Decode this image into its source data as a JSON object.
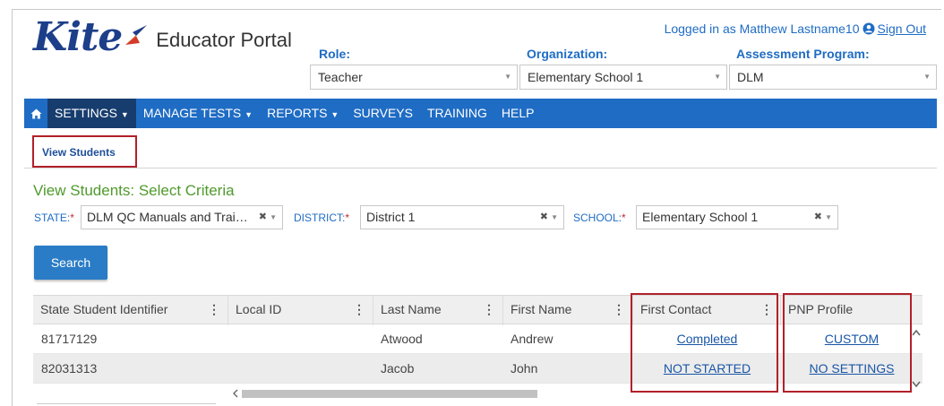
{
  "app": {
    "logo_text": "Kite",
    "portal_name": "Educator Portal"
  },
  "header": {
    "login_prefix": "Logged in as Matthew Lastname10",
    "sign_out": "Sign Out",
    "role_label": "Role:",
    "role_value": "Teacher",
    "org_label": "Organization:",
    "org_value": "Elementary School 1",
    "program_label": "Assessment Program:",
    "program_value": "DLM"
  },
  "nav": {
    "items": [
      {
        "label": "SETTINGS"
      },
      {
        "label": "MANAGE TESTS"
      },
      {
        "label": "REPORTS"
      },
      {
        "label": "SURVEYS"
      },
      {
        "label": "TRAINING"
      },
      {
        "label": "HELP"
      }
    ]
  },
  "tabs": {
    "view_students": "View Students"
  },
  "criteria": {
    "title": "View Students: Select Criteria",
    "state_label": "STATE:",
    "state_value": "DLM QC Manuals and Trai…",
    "district_label": "DISTRICT:",
    "district_value": "District 1",
    "school_label": "SCHOOL:",
    "school_value": "Elementary School 1",
    "required_mark": "*",
    "search_button": "Search"
  },
  "grid": {
    "columns": [
      "State Student Identifier",
      "Local ID",
      "Last Name",
      "First Name",
      "First Contact",
      "PNP Profile"
    ],
    "rows": [
      {
        "state_id": "81717129",
        "local_id": "",
        "last_name": "Atwood",
        "first_name": "Andrew",
        "first_contact": "Completed",
        "pnp_profile": "CUSTOM"
      },
      {
        "state_id": "82031313",
        "local_id": "",
        "last_name": "Jacob",
        "first_name": "John",
        "first_contact": "NOT STARTED",
        "pnp_profile": "NO SETTINGS"
      }
    ]
  },
  "colors": {
    "brand_blue": "#1f6cc4",
    "nav_active": "#173d6e",
    "criteria_green": "#4f9a2c",
    "highlight_red": "#b2202a"
  }
}
